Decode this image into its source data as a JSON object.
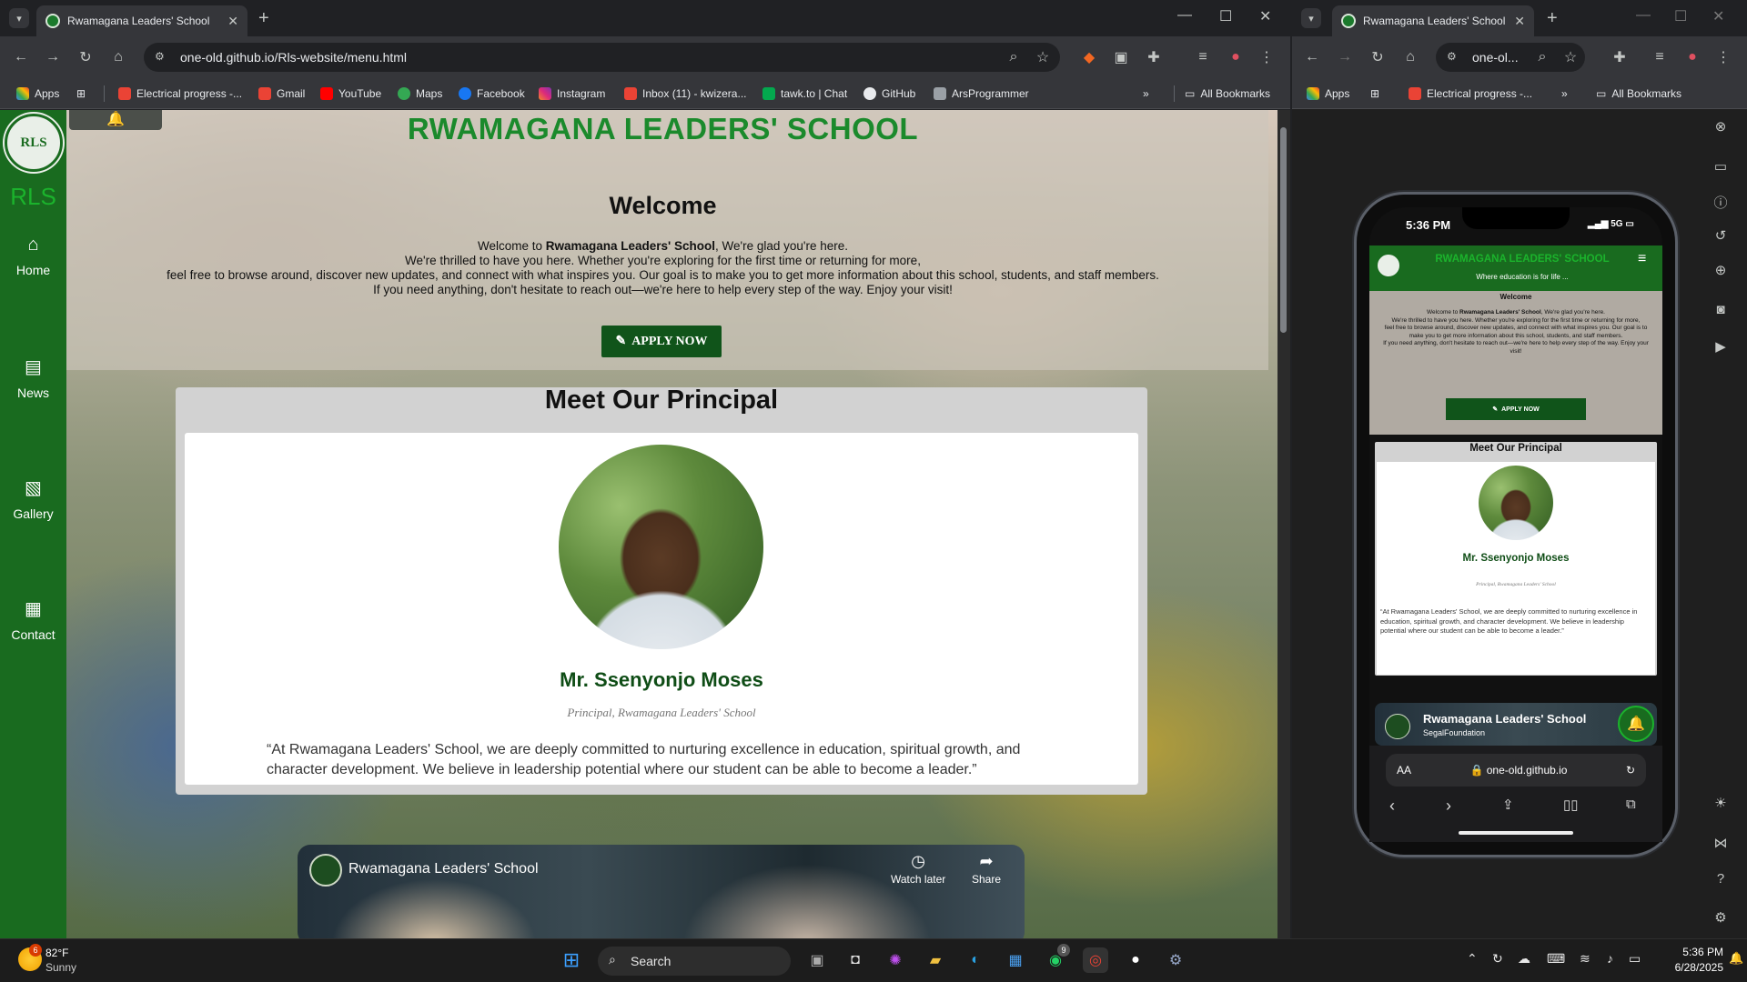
{
  "browser1": {
    "tab_title": "Rwamagana Leaders' School",
    "url": "one-old.github.io/Rls-website/menu.html",
    "bookmarks": [
      "Apps",
      "Electrical progress -...",
      "Gmail",
      "YouTube",
      "Maps",
      "Facebook",
      "Instagram",
      "Inbox (11) - kwizera...",
      "tawk.to | Chat",
      "GitHub",
      "ArsProgrammer"
    ],
    "all_bookmarks": "All Bookmarks"
  },
  "site": {
    "logo_text": "RLS",
    "rls_label": "RLS",
    "nav": [
      {
        "label": "Home",
        "icon": "home-icon"
      },
      {
        "label": "News",
        "icon": "newspaper-icon"
      },
      {
        "label": "Gallery",
        "icon": "image-icon"
      },
      {
        "label": "Contact",
        "icon": "contact-card-icon"
      }
    ],
    "school_name": "RWAMAGANA LEADERS' SCHOOL",
    "welcome_title": "Welcome",
    "welcome_lines": {
      "l1_pre": "Welcome to ",
      "l1_bold": "Rwamagana Leaders' School",
      "l1_post": ", We're glad you're here.",
      "l2": "We're thrilled to have you here. Whether you're exploring for the first time or returning for more,",
      "l3": "feel free to browse around, discover new updates, and connect with what inspires you. Our goal is to make you to get more information about this school, students, and staff members.",
      "l4": "If you need anything, don't hesitate to reach out—we're here to help every step of the way. Enjoy your visit!"
    },
    "apply_label": "APPLY NOW",
    "principal_section_title": "Meet Our Principal",
    "principal_name": "Mr. Ssenyonjo Moses",
    "principal_role": "Principal, Rwamagana Leaders' School",
    "principal_quote": "“At Rwamagana Leaders' School, we are deeply committed to nurturing excellence in education, spiritual growth, and character development. We believe in leadership potential where our student can be able to become a leader.”",
    "video_title": "Rwamagana Leaders' School",
    "video_watch_later": "Watch later",
    "video_share": "Share"
  },
  "browser2": {
    "tab_title": "Rwamagana Leaders' School",
    "url": "one-ol...",
    "bookmarks": [
      "Apps",
      "Electrical progress -..."
    ],
    "all_bookmarks": "All Bookmarks",
    "phone": {
      "time": "5:36 PM",
      "signal": "5G",
      "school_name": "RWAMAGANA LEADERS' SCHOOL",
      "tagline": "Where education is for life ...",
      "welcome_title": "Welcome",
      "welcome_text_pre": "Welcome to ",
      "welcome_text_bold": "Rwamagana Leaders' School",
      "welcome_text_post": ", We're glad you're here.",
      "welcome_text_l2": "We're thrilled to have you here. Whether you're exploring for the first time or returning for more,",
      "welcome_text_l3": "feel free to browse around, discover new updates, and connect with what inspires you. Our goal is to make you to get more information about this school, students, and staff members.",
      "welcome_text_l4": "If you need anything, don't hesitate to reach out—we're here to help every step of the way. Enjoy your visit!",
      "apply_label": "APPLY NOW",
      "principal_section_title": "Meet Our Principal",
      "principal_name": "Mr. Ssenyonjo Moses",
      "principal_role": "Principal, Rwamagana Leaders' School",
      "principal_quote": "“At Rwamagana Leaders' School, we are deeply committed to nurturing excellence in education, spiritual growth, and character development. We believe in leadership potential where our student can be able to become a leader.”",
      "video_title": "Rwamagana Leaders' School",
      "video_channel": "SegalFoundation",
      "safari_aa": "AA",
      "safari_url": "one-old.github.io"
    }
  },
  "taskbar": {
    "weather_temp": "82°F",
    "weather_desc": "Sunny",
    "weather_badge": "6",
    "search_placeholder": "Search",
    "whatsapp_badge": "9",
    "time": "5:36 PM",
    "date": "6/28/2025"
  },
  "colors": {
    "brand_green": "#196b1f",
    "title_green": "#1b8a2c",
    "dark_green": "#10541a"
  }
}
